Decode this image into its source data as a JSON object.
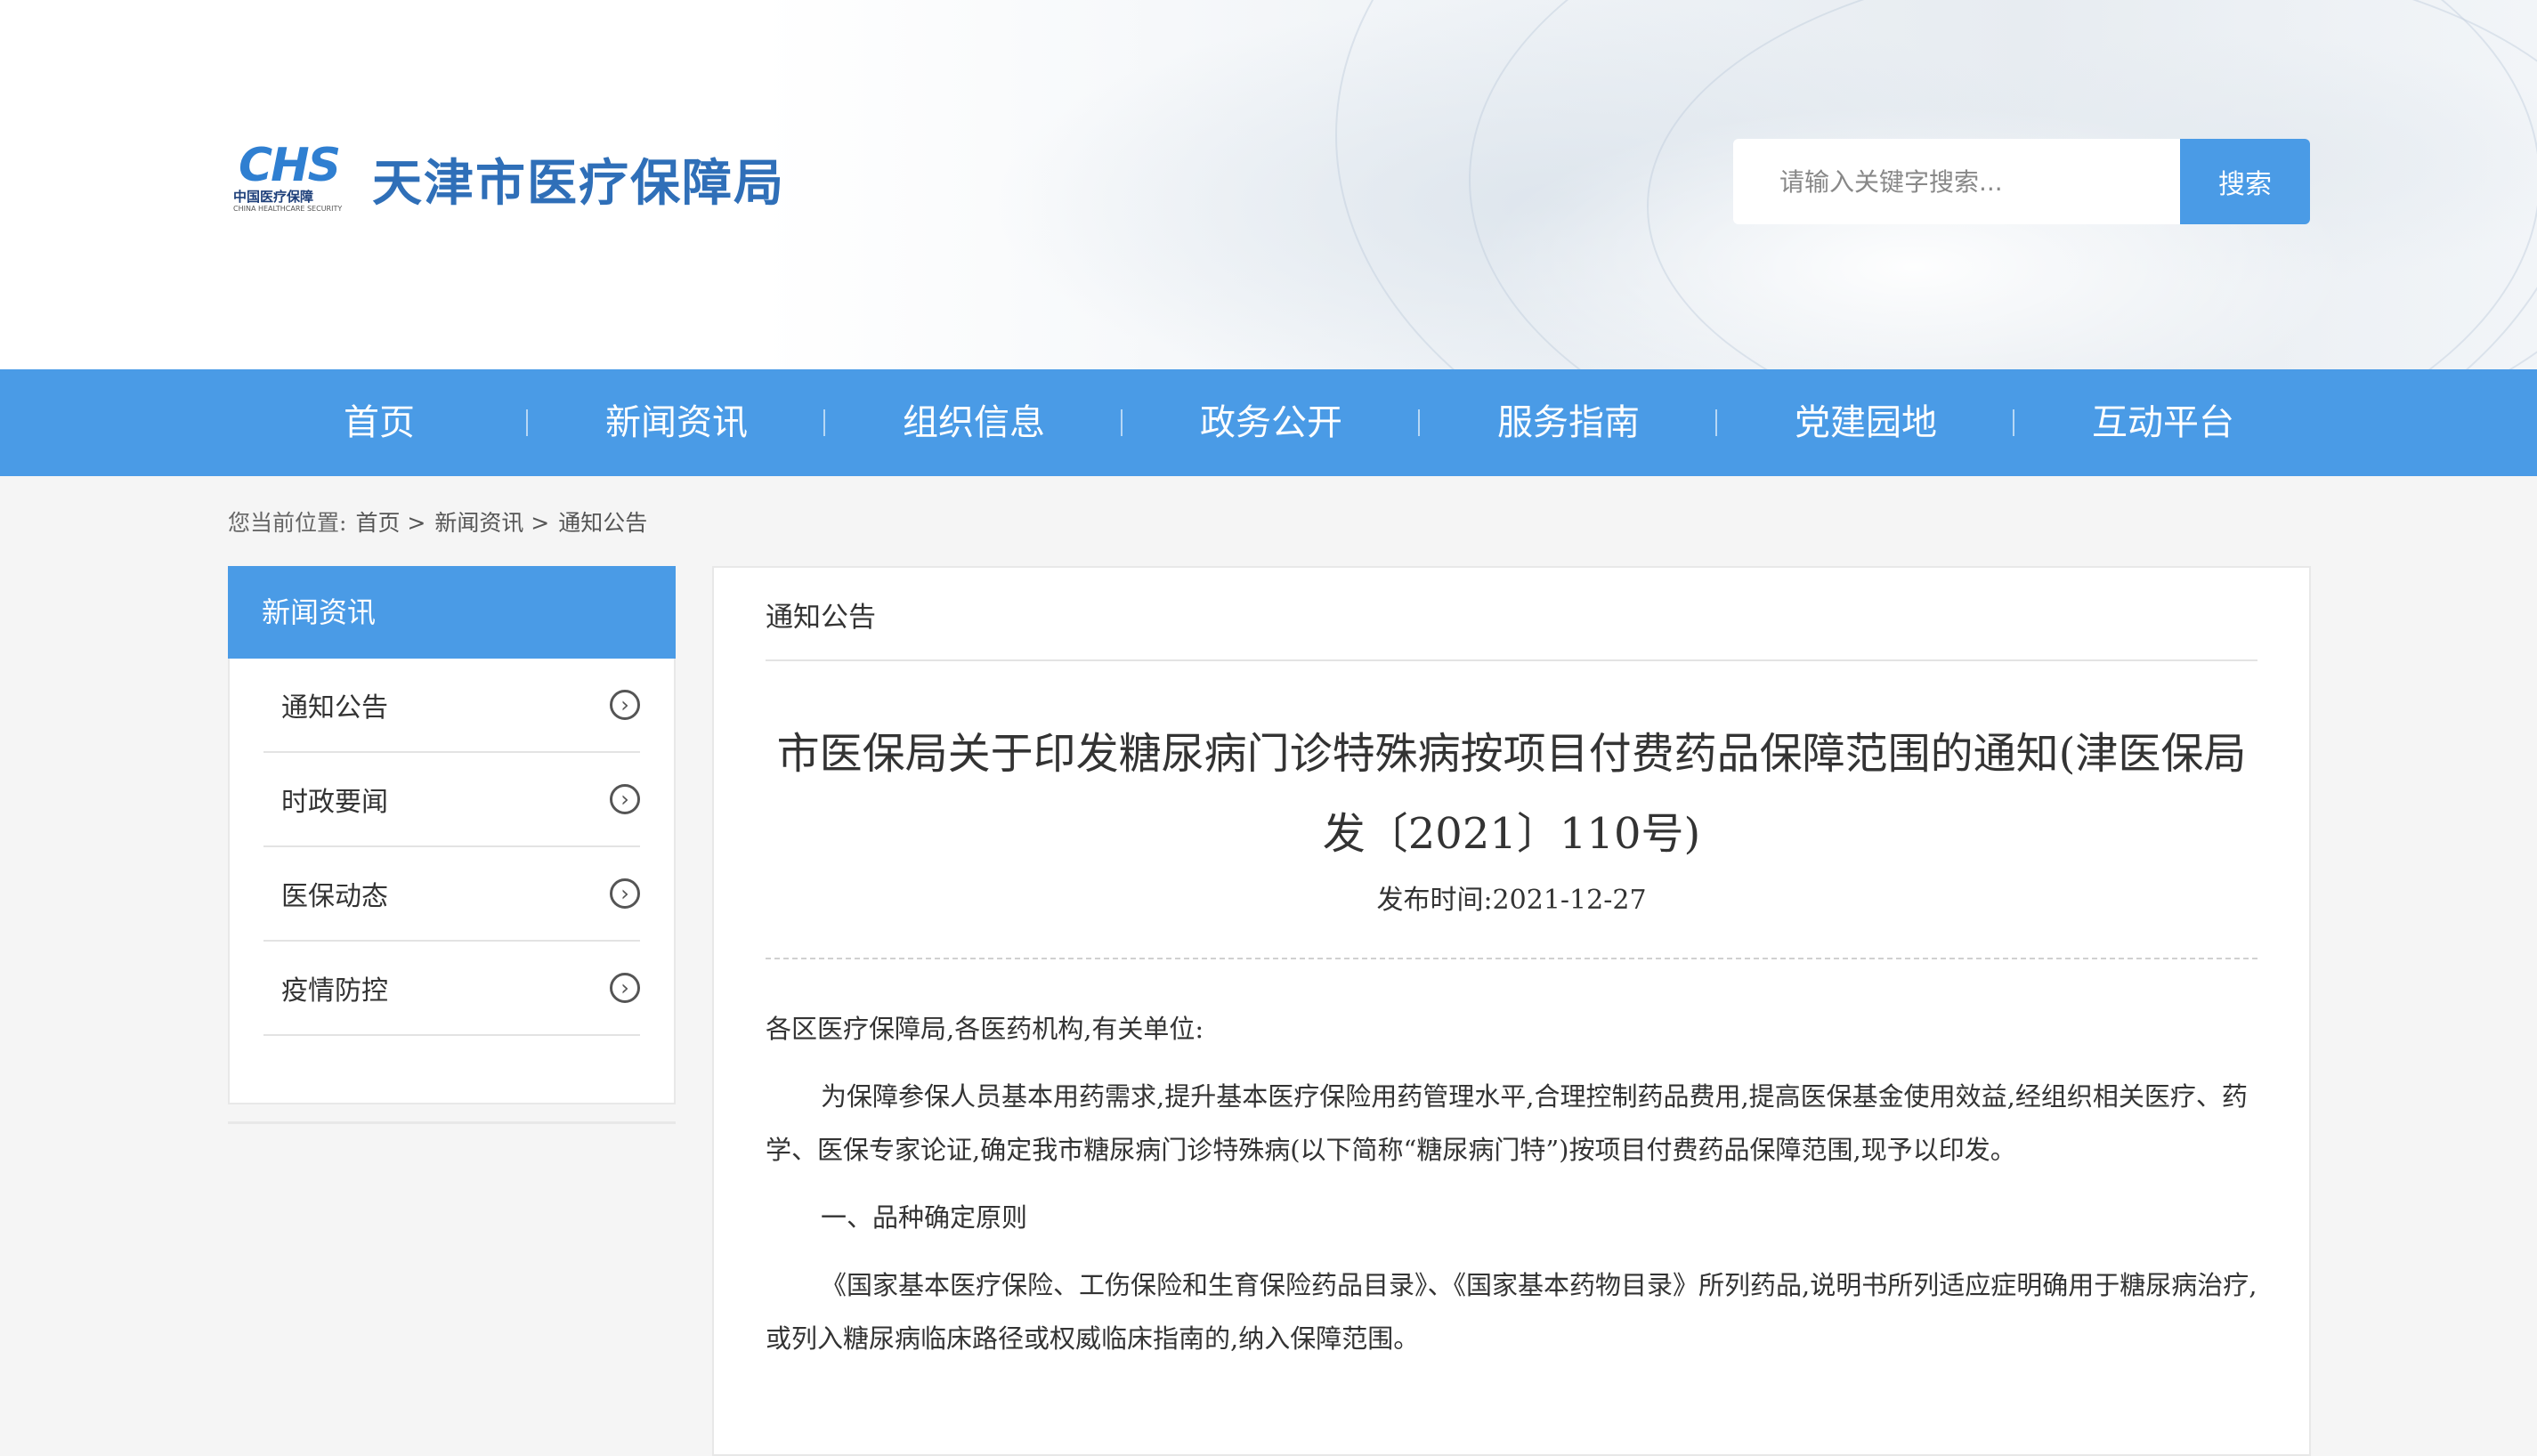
{
  "site": {
    "logo_mark": "CHS",
    "logo_cn": "中国医疗保障",
    "logo_en": "CHINA HEALTHCARE SECURITY",
    "title": "天津市医疗保障局"
  },
  "search": {
    "placeholder": "请输入关键字搜索...",
    "button_label": "搜索"
  },
  "nav": {
    "items": [
      "首页",
      "新闻资讯",
      "组织信息",
      "政务公开",
      "服务指南",
      "党建园地",
      "互动平台"
    ]
  },
  "breadcrumb": {
    "label": "您当前位置:",
    "home": "首页 >",
    "news": "新闻资讯 >",
    "current": "通知公告"
  },
  "sidebar": {
    "title": "新闻资讯",
    "items": [
      "通知公告",
      "时政要闻",
      "医保动态",
      "疫情防控"
    ]
  },
  "main": {
    "section": "通知公告",
    "title": "市医保局关于印发糖尿病门诊特殊病按项目付费药品保障范围的通知(津医保局发〔2021〕110号)",
    "date": "发布时间:2021-12-27",
    "salutation": "各区医疗保障局,各医药机构,有关单位:",
    "para1": "为保障参保人员基本用药需求,提升基本医疗保险用药管理水平,合理控制药品费用,提高医保基金使用效益,经组织相关医疗、药学、医保专家论证,确定我市糖尿病门诊特殊病(以下简称“糖尿病门特”)按项目付费药品保障范围,现予以印发。",
    "heading1": "一、品种确定原则",
    "para2": "《国家基本医疗保险、工伤保险和生育保险药品目录》、《国家基本药物目录》所列药品,说明书所列适应症明确用于糖尿病治疗,或列入糖尿病临床路径或权威临床指南的,纳入保障范围。"
  },
  "colors": {
    "primary": "#4a9be6",
    "logo_blue": "#2f6fb8"
  }
}
